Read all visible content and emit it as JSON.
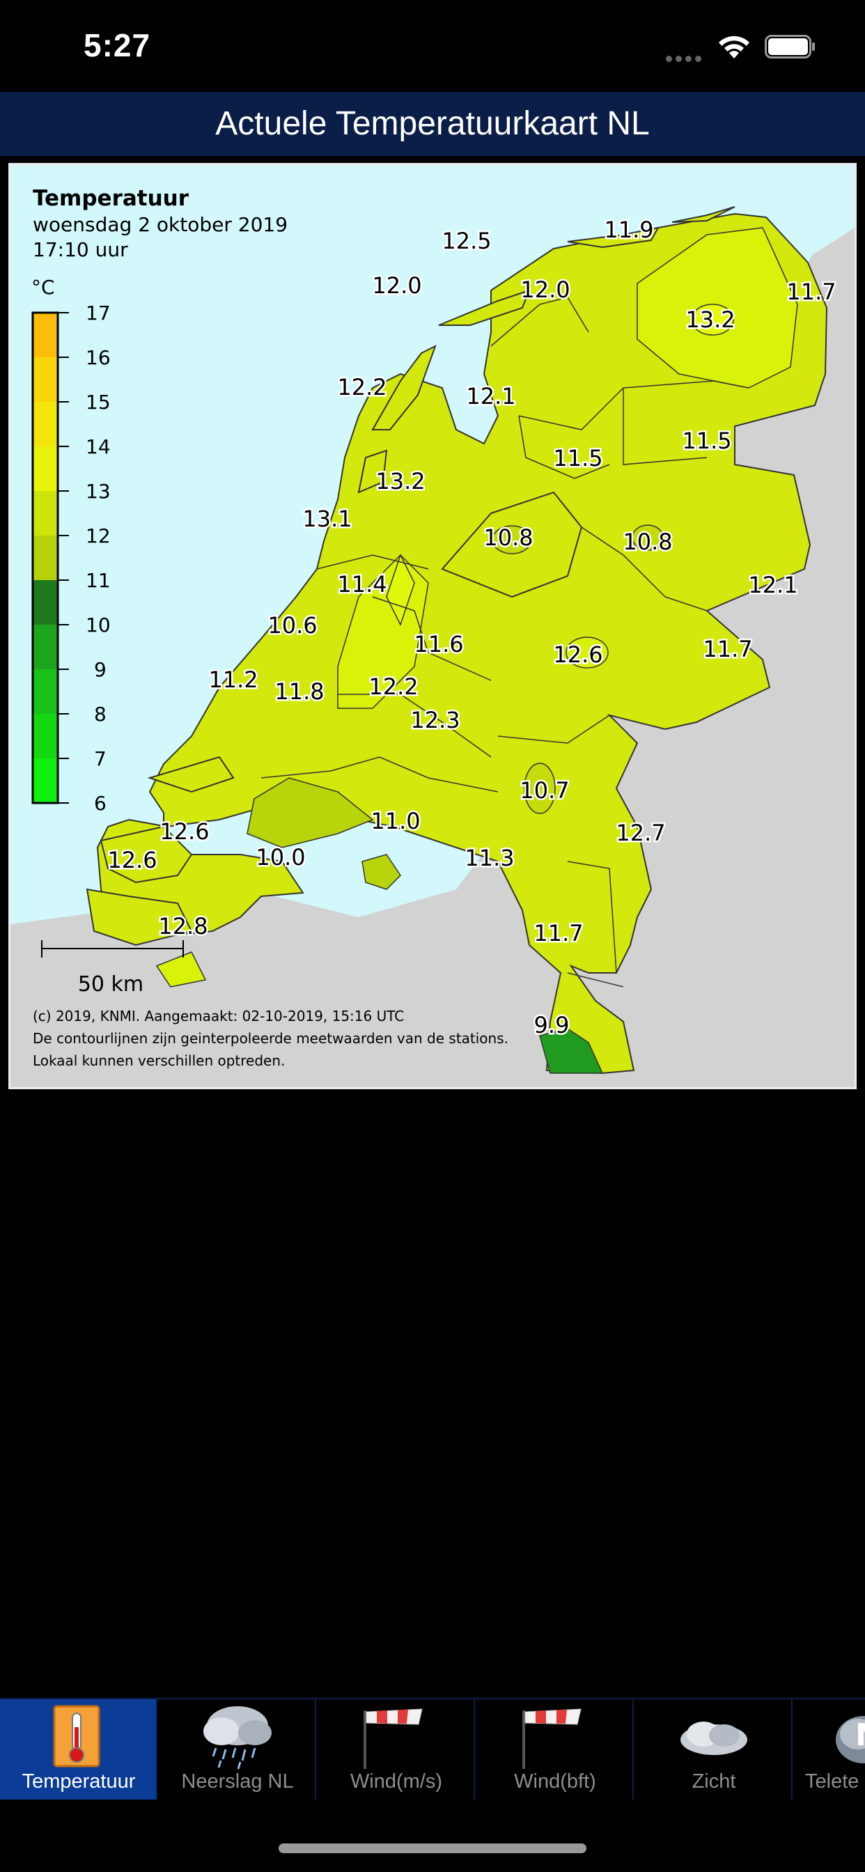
{
  "status_bar": {
    "time": "5:27"
  },
  "header": {
    "title": "Actuele Temperatuurkaart NL"
  },
  "map": {
    "title": "Temperatuur",
    "date": "woensdag 2 oktober 2019",
    "time": "17:10 uur",
    "legend": {
      "unit": "°C",
      "ticks": [
        "17",
        "16",
        "15",
        "14",
        "13",
        "12",
        "11",
        "10",
        "9",
        "8",
        "7",
        "6"
      ]
    },
    "labels": [
      {
        "text": "12.5"
      },
      {
        "text": "11.9"
      },
      {
        "text": "12.0"
      },
      {
        "text": "12.0"
      },
      {
        "text": "11.7"
      },
      {
        "text": "13.2"
      },
      {
        "text": "12.2"
      },
      {
        "text": "12.1"
      },
      {
        "text": "11.5"
      },
      {
        "text": "11.5"
      },
      {
        "text": "13.2"
      },
      {
        "text": "13.1"
      },
      {
        "text": "10.8"
      },
      {
        "text": "10.8"
      },
      {
        "text": "11.4"
      },
      {
        "text": "12.1"
      },
      {
        "text": "10.6"
      },
      {
        "text": "11.6"
      },
      {
        "text": "12.6"
      },
      {
        "text": "11.7"
      },
      {
        "text": "11.2"
      },
      {
        "text": "11.8"
      },
      {
        "text": "12.2"
      },
      {
        "text": "12.3"
      },
      {
        "text": "10.7"
      },
      {
        "text": "11.0"
      },
      {
        "text": "12.6"
      },
      {
        "text": "12.7"
      },
      {
        "text": "12.6"
      },
      {
        "text": "10.0"
      },
      {
        "text": "11.3"
      },
      {
        "text": "12.8"
      },
      {
        "text": "11.7"
      },
      {
        "text": "9.9"
      }
    ],
    "scale_label": "50 km",
    "credit_lines": [
      "(c) 2019, KNMI. Aangemaakt: 02-10-2019, 15:16 UTC",
      "De contourlijnen zijn geinterpoleerde meetwaarden van de stations.",
      "Lokaal kunnen verschillen optreden."
    ]
  },
  "tabs": [
    {
      "label": "Temperatuur",
      "icon": "thermometer-icon",
      "active": true
    },
    {
      "label": "Neerslag NL",
      "icon": "rain-cloud-icon",
      "active": false
    },
    {
      "label": "Wind(m/s)",
      "icon": "windsock-icon",
      "active": false
    },
    {
      "label": "Wind(bft)",
      "icon": "windsock-icon",
      "active": false
    },
    {
      "label": "Zicht",
      "icon": "fog-cloud-icon",
      "active": false
    },
    {
      "label": "Telete",
      "icon": "teletext-icon",
      "active": false
    }
  ]
}
